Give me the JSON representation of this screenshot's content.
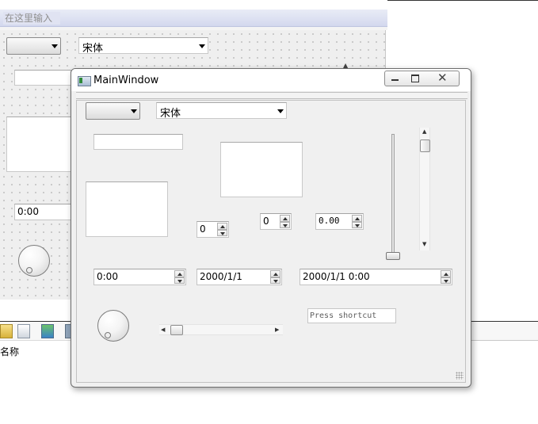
{
  "background_designer": {
    "menu_placeholder": "在这里输入",
    "font_combo_value": "宋体",
    "time_value": "0:00",
    "explorer_column": "名称"
  },
  "main_window": {
    "title": "MainWindow",
    "font_combo_value": "宋体",
    "spin_int_1": "0",
    "spin_int_2": "0",
    "spin_double": "0.00",
    "time_edit": "0:00",
    "date_edit": "2000/1/1",
    "datetime_edit": "2000/1/1 0:00",
    "key_sequence_placeholder": "Press shortcut",
    "vslider_value": 0,
    "vscroll_value": 0,
    "hscroll_value": 0
  },
  "icons": {
    "minimize": "minimize-icon",
    "maximize": "maximize-icon",
    "close": "close-icon"
  }
}
